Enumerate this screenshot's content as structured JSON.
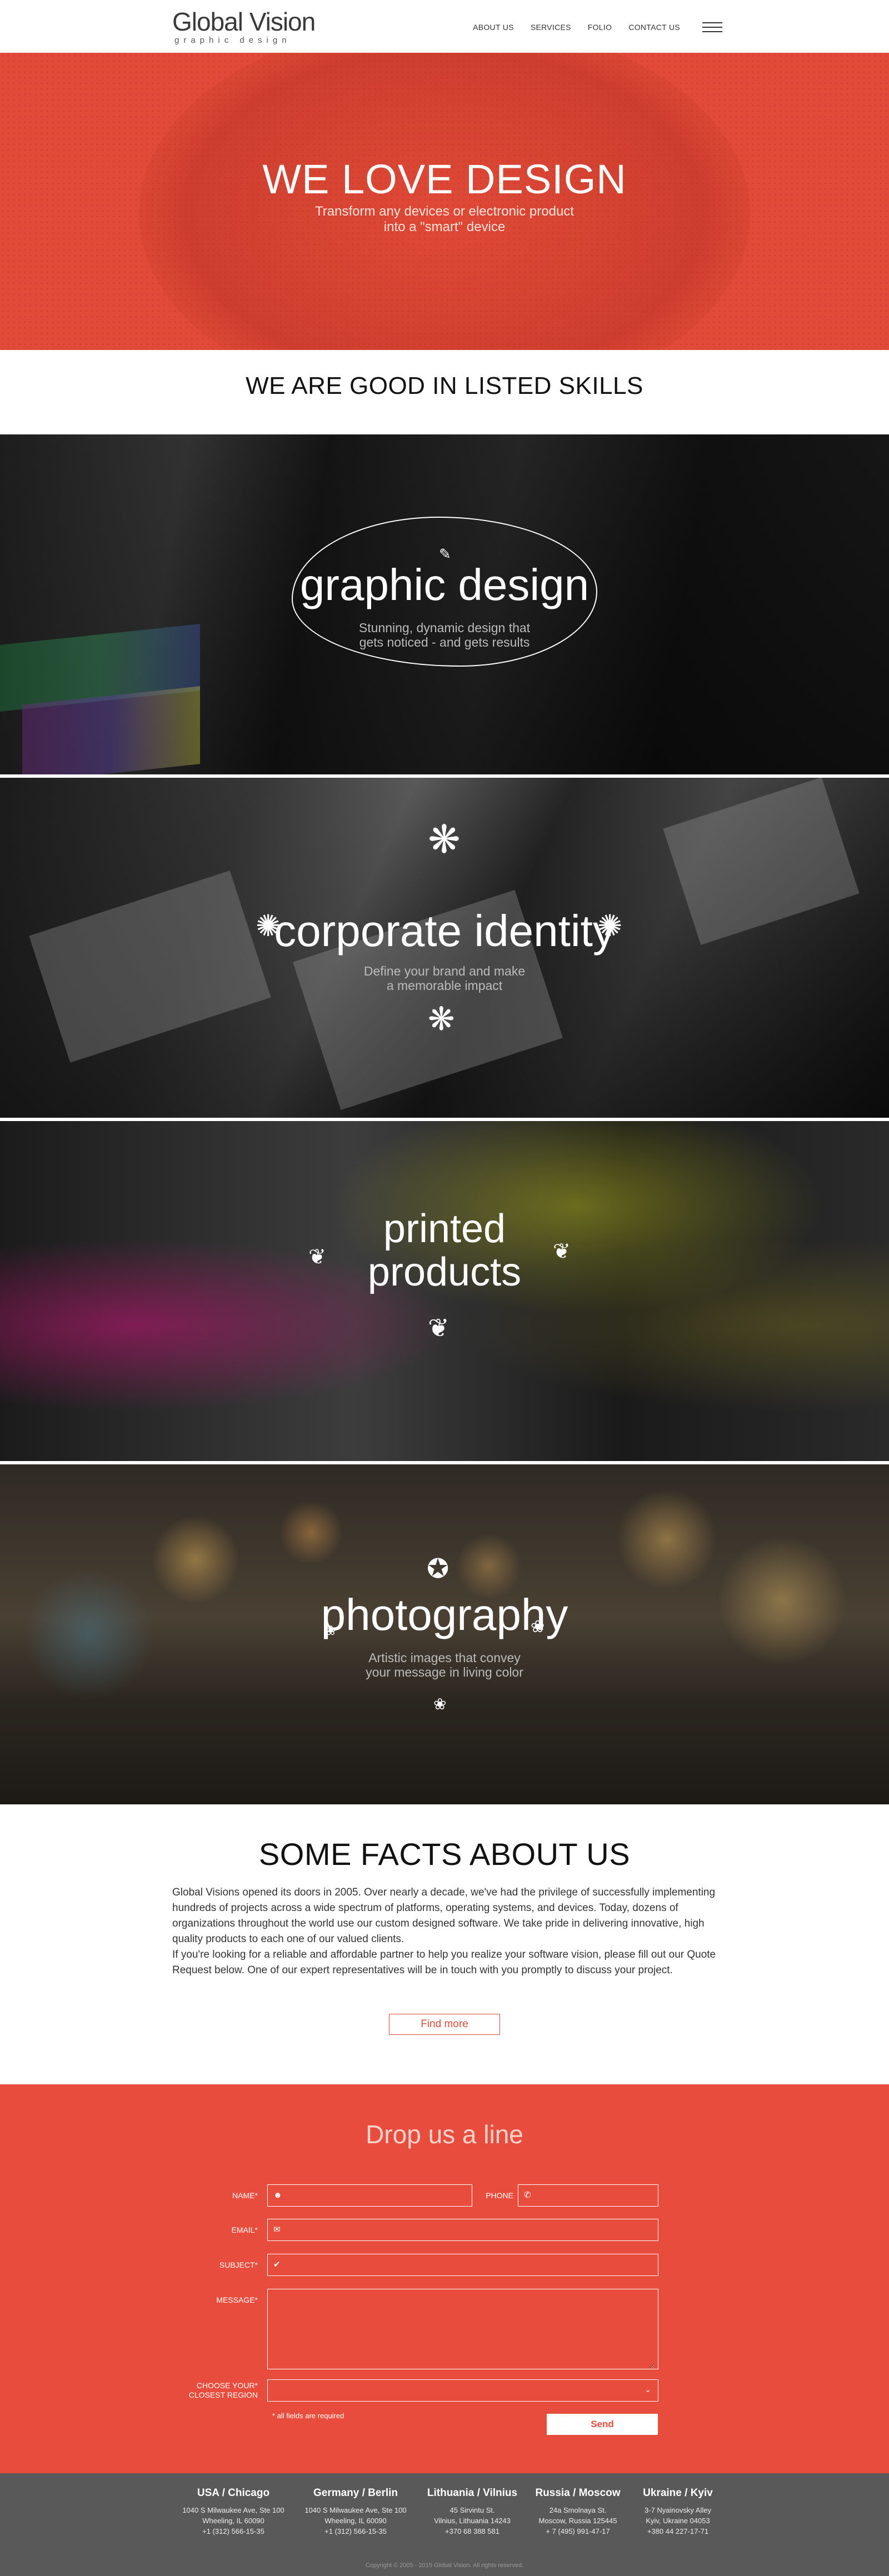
{
  "header": {
    "logo_name": "Global Vision",
    "logo_sub": "graphic design",
    "nav": [
      "ABOUT US",
      "SERVICES",
      "FOLIO",
      "CONTACT US"
    ]
  },
  "hero": {
    "title": "WE LOVE DESIGN",
    "subtitle_line1": "Transform any devices or electronic product",
    "subtitle_line2": "into a \"smart\" device"
  },
  "skills": {
    "heading": "WE ARE GOOD IN LISTED SKILLS",
    "items": [
      {
        "title": "graphic design",
        "desc_line1": "Stunning, dynamic design that",
        "desc_line2": "gets noticed - and gets results"
      },
      {
        "title": "corporate identity",
        "desc_line1": "Define your brand and make",
        "desc_line2": "a memorable impact"
      },
      {
        "title_line1": "printed",
        "title_line2": "products"
      },
      {
        "title": "photography",
        "desc_line1": "Artistic images that convey",
        "desc_line2": "your message in living color"
      }
    ]
  },
  "facts": {
    "title": "SOME FACTS ABOUT US",
    "paragraph1": "Global Visions opened its doors in 2005. Over nearly a decade, we've had the privilege of successfully implementing hundreds of projects across a wide spectrum of platforms, operating systems, and devices. Today, dozens of organizations throughout the world use our custom designed software. We take pride in delivering innovative, high quality products to each one of our valued clients.",
    "paragraph2": "If you're looking for a reliable and affordable partner to help you realize your software vision, please fill out our Quote Request below. One of our expert representatives will be in touch with you promptly to discuss your project.",
    "button": "Find more"
  },
  "contact": {
    "title": "Drop us a line",
    "labels": {
      "name": "NAME*",
      "phone": "PHONE",
      "email": "EMAIL*",
      "subject": "SUBJECT*",
      "message": "MESSAGE*",
      "region_line1": "CHOOSE YOUR*",
      "region_line2": "CLOSEST REGION"
    },
    "required_note": "* all fields are required",
    "send": "Send"
  },
  "footer": {
    "offices": [
      {
        "title": "USA / Chicago",
        "lines": [
          "1040 S Milwaukee Ave, Ste 100",
          "Wheeling, IL 60090",
          "+1 (312) 566-15-35"
        ]
      },
      {
        "title": "Germany / Berlin",
        "lines": [
          "1040 S Milwaukee Ave, Ste 100",
          "Wheeling, IL 60090",
          "+1 (312) 566-15-35"
        ]
      },
      {
        "title": "Lithuania / Vilnius",
        "lines": [
          "45 Sirvintu St.",
          "Vilnius, Lithuania 14243",
          "+370 68 388 581"
        ]
      },
      {
        "title": "Russia / Moscow",
        "lines": [
          "24a Smolnaya St.",
          "Moscow, Russia 125445",
          "+ 7 (495) 991-47-17"
        ]
      },
      {
        "title": "Ukraine / Kyiv",
        "lines": [
          "3-7 Nyainovsky Alley",
          "Kyiv, Ukraine 04053",
          "+380 44 227-17-71"
        ]
      }
    ],
    "copyright": "Copyright © 2005 - 2015 Global Vision. All rights reserved."
  },
  "colors": {
    "accent": "#e74c3c",
    "hero": "#e04a37",
    "footer": "#595959"
  }
}
